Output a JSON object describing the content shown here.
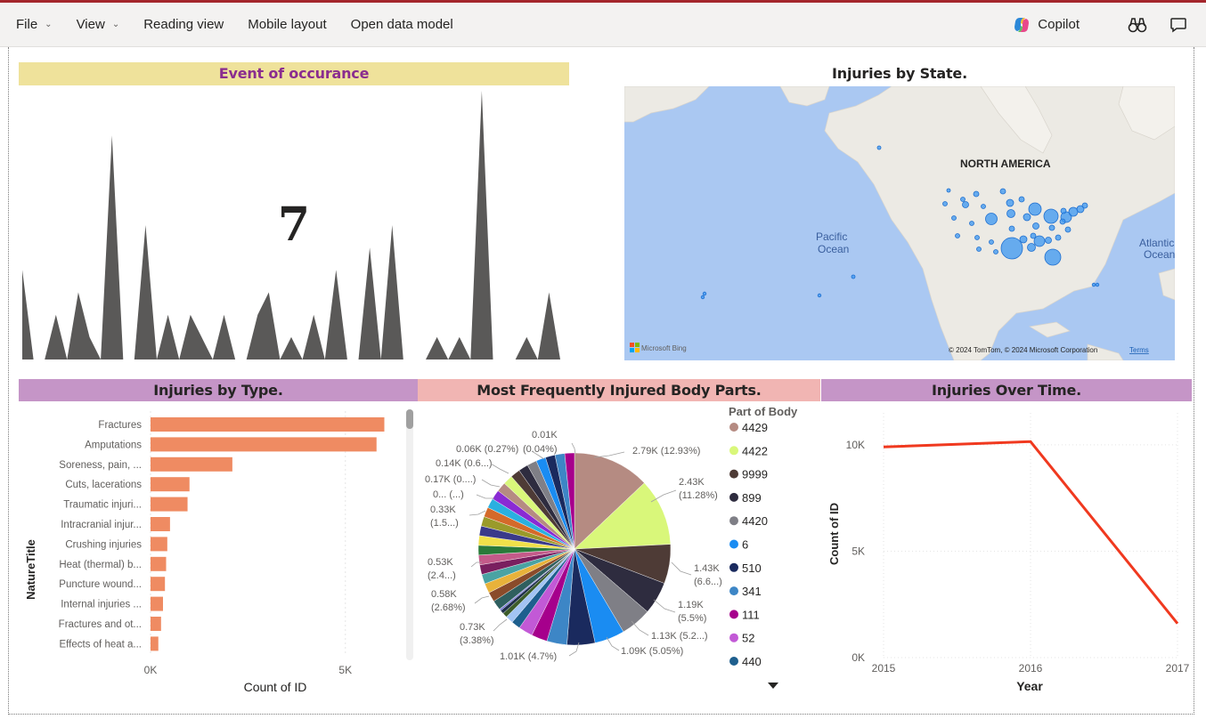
{
  "menubar": {
    "file": "File",
    "view": "View",
    "reading_view": "Reading view",
    "mobile_layout": "Mobile layout",
    "open_data_model": "Open data model",
    "copilot": "Copilot"
  },
  "event_chart": {
    "title": "Event of occurance",
    "card_value": "7",
    "values": [
      4,
      0,
      0,
      2,
      0,
      3,
      1,
      0,
      10,
      0,
      0,
      6,
      0,
      2,
      0,
      2,
      1,
      0,
      2,
      0,
      0,
      2,
      3,
      0,
      1,
      0,
      2,
      0,
      4,
      0,
      0,
      5,
      0,
      6,
      0,
      0,
      0,
      1,
      0,
      1,
      0,
      12,
      0,
      0,
      0,
      1,
      0,
      3,
      0
    ]
  },
  "map": {
    "title": "Injuries by State.",
    "label_na": "NORTH AMERICA",
    "label_pacific_1": "Pacific",
    "label_pacific_2": "Ocean",
    "label_atlantic_1": "Atlantic",
    "label_atlantic_2": "Ocean",
    "bing": "Microsoft Bing",
    "copyright": "© 2024 TomTom, © 2024 Microsoft Corporation",
    "terms": "Terms",
    "colors": {
      "water": "#aac8f2",
      "land": "#eceae4",
      "bubble": "#3a96f2"
    }
  },
  "bar_chart": {
    "title": "Injuries by Type.",
    "ylabel": "NatureTitle",
    "xlabel": "Count of ID",
    "ticks": [
      "0K",
      "5K"
    ],
    "color": "#ef8b62",
    "chart_data": {
      "type": "bar",
      "categories": [
        "Fractures",
        "Amputations",
        "Soreness, pain, ...",
        "Cuts, lacerations",
        "Traumatic injuri...",
        "Intracranial injur...",
        "Crushing injuries",
        "Heat (thermal) b...",
        "Puncture wound...",
        "Internal injuries ...",
        "Fractures and ot...",
        "Effects of heat a..."
      ],
      "values": [
        6000,
        5800,
        2100,
        1000,
        950,
        500,
        430,
        400,
        370,
        320,
        270,
        200
      ],
      "xlim": [
        0,
        8000
      ]
    }
  },
  "pie_chart": {
    "title": "Most Frequently Injured Body Parts.",
    "legend_title": "Part of Body",
    "legend": [
      {
        "name": "4429",
        "color": "#b58b82"
      },
      {
        "name": "4422",
        "color": "#d9f77a"
      },
      {
        "name": "9999",
        "color": "#4e3b36"
      },
      {
        "name": "899",
        "color": "#2e2c3f"
      },
      {
        "name": "4420",
        "color": "#7f7f86"
      },
      {
        "name": "6",
        "color": "#1a8cf2"
      },
      {
        "name": "510",
        "color": "#1a2a5e"
      },
      {
        "name": "341",
        "color": "#3d86c6"
      },
      {
        "name": "111",
        "color": "#a6008c"
      },
      {
        "name": "52",
        "color": "#c259d6"
      },
      {
        "name": "440",
        "color": "#1e5f8e"
      }
    ],
    "labels": [
      {
        "l1": "2.79K (12.93%)",
        "l2": ""
      },
      {
        "l1": "2.43K",
        "l2": "(11.28%)"
      },
      {
        "l1": "1.43K",
        "l2": "(6.6...)"
      },
      {
        "l1": "1.19K",
        "l2": "(5.5%)"
      },
      {
        "l1": "1.13K (5.2...)",
        "l2": ""
      },
      {
        "l1": "1.09K (5.05%)",
        "l2": ""
      },
      {
        "l1": "1.01K (4.7%)",
        "l2": ""
      },
      {
        "l1": "0.73K",
        "l2": "(3.38%)"
      },
      {
        "l1": "0.58K",
        "l2": "(2.68%)"
      },
      {
        "l1": "0.53K",
        "l2": "(2.4...)"
      },
      {
        "l1": "0.33K",
        "l2": "(1.5...)"
      },
      {
        "l1": "0... (...)",
        "l2": ""
      },
      {
        "l1": "0.17K (0....)",
        "l2": ""
      },
      {
        "l1": "0.14K (0.6...)",
        "l2": ""
      },
      {
        "l1": "0.06K (0.27%)",
        "l2": ""
      },
      {
        "l1": "(0.04%)",
        "l2": ""
      },
      {
        "l1": "0.01K",
        "l2": ""
      }
    ],
    "chart_data": {
      "type": "pie",
      "values": [
        12.93,
        11.28,
        6.6,
        5.5,
        5.2,
        5.05,
        4.7,
        3.38,
        2.68,
        2.4,
        1.5,
        1.3,
        0.8,
        0.6,
        0.27,
        0.04
      ]
    }
  },
  "line_chart": {
    "title": "Injuries Over Time.",
    "ylabel": "Count of ID",
    "xlabel": "Year",
    "yticks": [
      "10K",
      "5K",
      "0K"
    ],
    "xticks": [
      "2015",
      "2016",
      "2017"
    ],
    "color": "#f0391f",
    "chart_data": {
      "type": "line",
      "x": [
        2015,
        2016,
        2017
      ],
      "y": [
        9900,
        10150,
        1600
      ],
      "ylim": [
        0,
        11500
      ]
    }
  }
}
